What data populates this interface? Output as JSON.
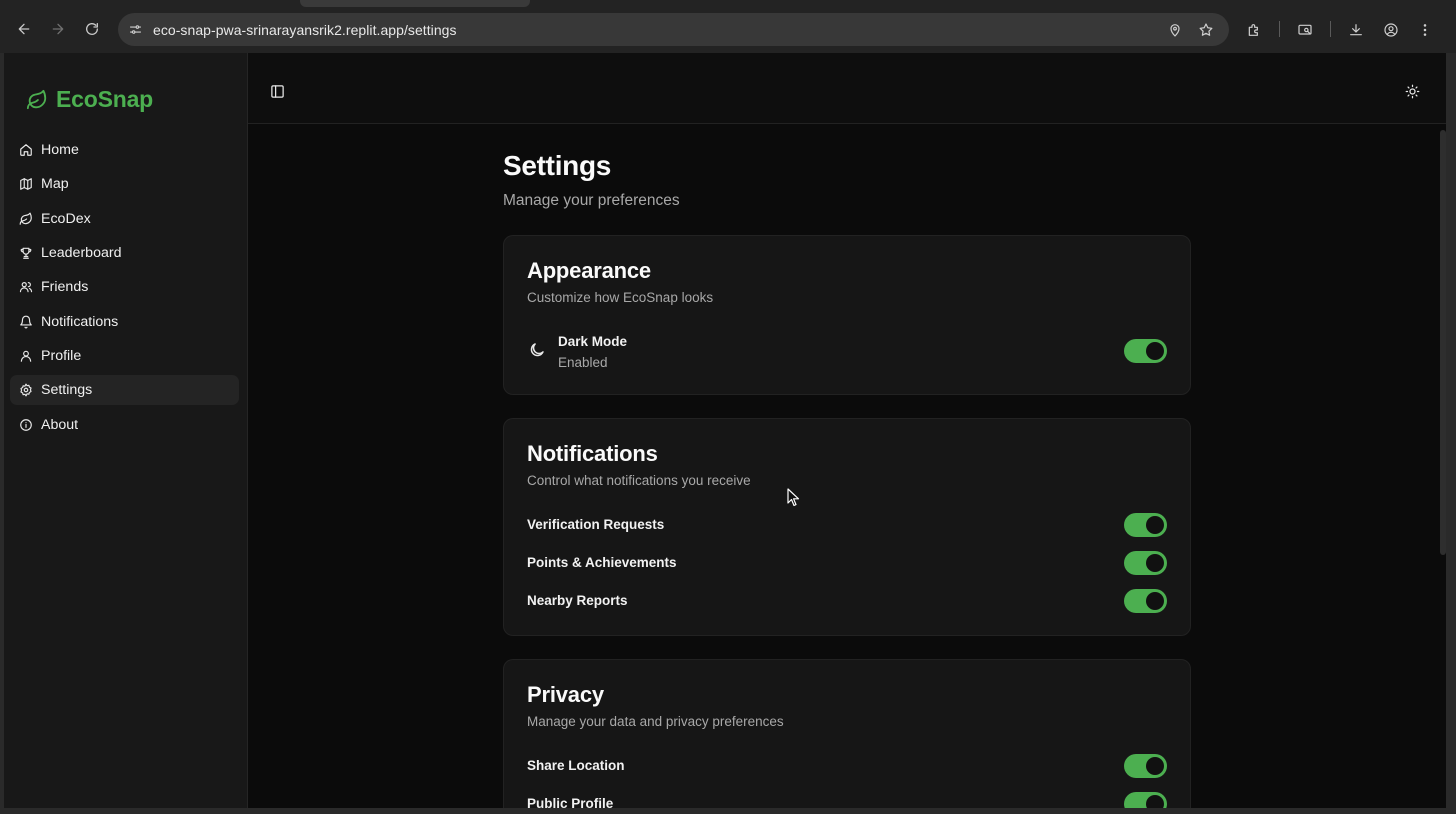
{
  "browser": {
    "url_host": "eco-snap-pwa-srinarayansrik2.replit.app",
    "url_path": "/settings"
  },
  "app": {
    "brand": "EcoSnap",
    "accent_color": "#4caf50"
  },
  "sidebar": {
    "items": [
      {
        "label": "Home",
        "icon": "home-icon"
      },
      {
        "label": "Map",
        "icon": "map-icon"
      },
      {
        "label": "EcoDex",
        "icon": "leaf-icon"
      },
      {
        "label": "Leaderboard",
        "icon": "trophy-icon"
      },
      {
        "label": "Friends",
        "icon": "users-icon"
      },
      {
        "label": "Notifications",
        "icon": "bell-icon"
      },
      {
        "label": "Profile",
        "icon": "user-icon"
      },
      {
        "label": "Settings",
        "icon": "gear-icon",
        "active": true
      },
      {
        "label": "About",
        "icon": "info-icon"
      }
    ]
  },
  "page": {
    "title": "Settings",
    "subtitle": "Manage your preferences"
  },
  "appearance": {
    "title": "Appearance",
    "description": "Customize how EcoSnap looks",
    "dark_mode_label": "Dark Mode",
    "dark_mode_state": "Enabled",
    "dark_mode_on": true
  },
  "notifications": {
    "title": "Notifications",
    "description": "Control what notifications you receive",
    "items": [
      {
        "label": "Verification Requests",
        "on": true
      },
      {
        "label": "Points & Achievements",
        "on": true
      },
      {
        "label": "Nearby Reports",
        "on": true
      }
    ]
  },
  "privacy": {
    "title": "Privacy",
    "description": "Manage your data and privacy preferences",
    "items": [
      {
        "label": "Share Location",
        "on": true
      },
      {
        "label": "Public Profile",
        "on": true
      }
    ]
  }
}
